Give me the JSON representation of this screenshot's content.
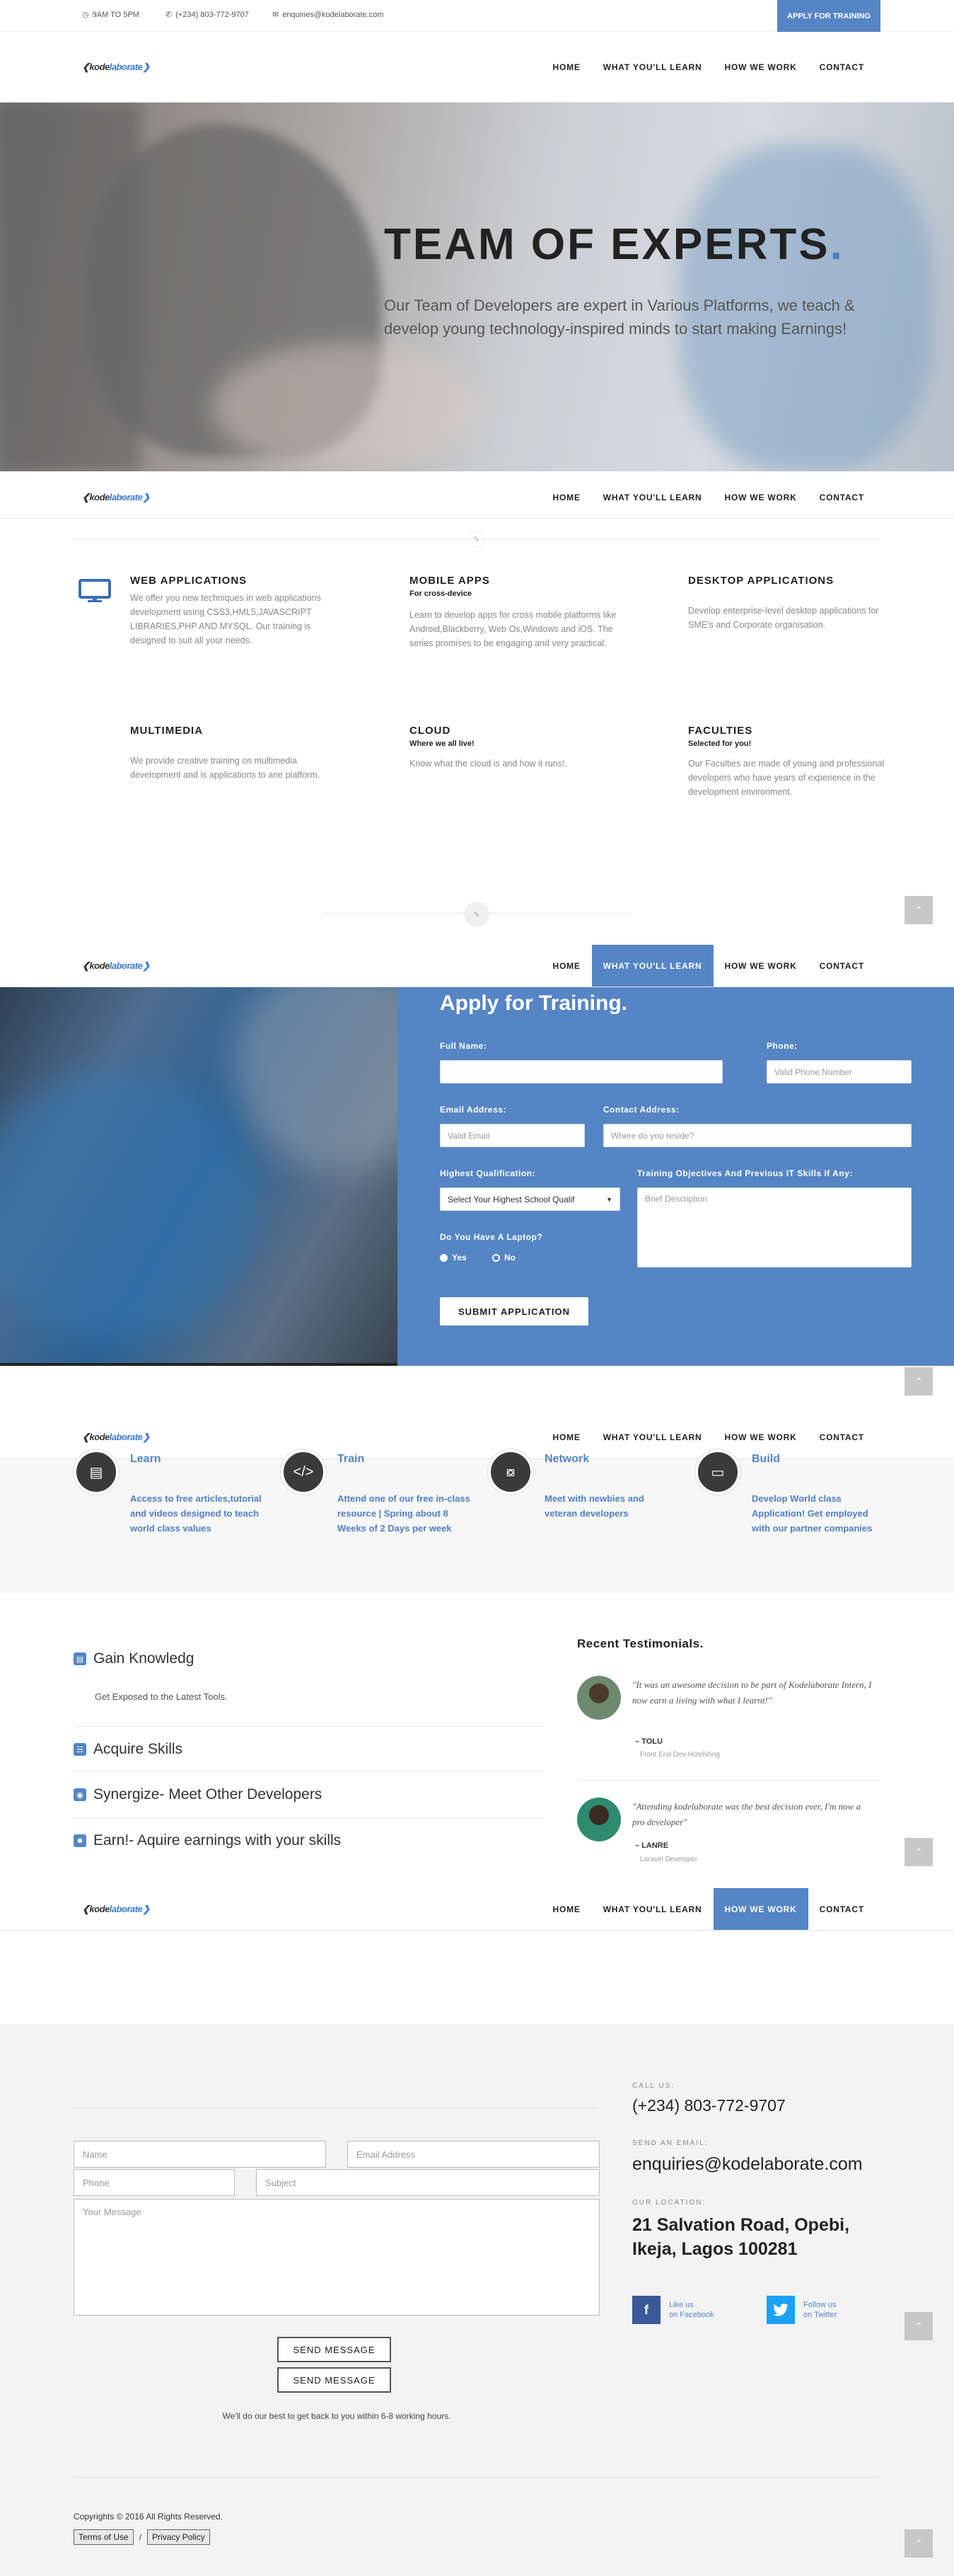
{
  "topbar": {
    "hours": "9AM TO 5PM",
    "phone": "(+234) 803-772-9707",
    "email": "enquiries@kodelaborate.com",
    "apply_label": "APPLY FOR TRAINING"
  },
  "logo": {
    "part1": "kode",
    "part2": "laborate"
  },
  "nav": {
    "items": [
      "HOME",
      "WHAT YOU'LL LEARN",
      "HOW WE WORK",
      "CONTACT"
    ]
  },
  "hero": {
    "title": "TEAM OF EXPERTS",
    "title_dot": ".",
    "subtitle": "Our Team of Developers are expert in Various Platforms, we teach & develop young technology-inspired minds to start making Earnings!"
  },
  "services": [
    {
      "title": "WEB APPLICATIONS",
      "subtitle": "",
      "text": "We offer you new techniques in web applications development using CSS3,HML5,JAVASCRIPT LIBRARIES,PHP AND MYSQL. Our training is designed to suit all your needs."
    },
    {
      "title": "MOBILE APPS",
      "subtitle": "For cross-device",
      "text": "Learn to develop apps for cross mobile platforms like Android,Blackberry, Web Os,Windows and iOS. The series promises to be engaging and very practical."
    },
    {
      "title": "DESKTOP APPLICATIONS",
      "subtitle": "",
      "text": "Develop enterprise-level desktop applications for SME's and Corporate organisation."
    },
    {
      "title": "MULTIMEDIA",
      "subtitle": "",
      "text": "We provide creative training on multimedia development and is applications to ane platform."
    },
    {
      "title": "CLOUD",
      "subtitle": "Where we all live!",
      "text": "Know what the cloud is and how it runs!."
    },
    {
      "title": "FACULTIES",
      "subtitle": "Selected for you!",
      "text": "Our Faculties are made of young and professional developers who have years of experience in the development environment."
    }
  ],
  "apply": {
    "title": "Apply for Training.",
    "full_name_label": "Full Name:",
    "phone_label": "Phone:",
    "phone_placeholder": "Valid Phone Number",
    "email_label": "Email Address:",
    "email_placeholder": "Valid Email",
    "contact_label": "Contact Address:",
    "contact_placeholder": "Where do you reside?",
    "qualification_label": "Highest Qualification:",
    "qualification_value": "Select Your Highest School Qualif",
    "objectives_label": "Training Objectives And Previous IT Skills If Any:",
    "objectives_placeholder": "Brief Description",
    "laptop_label": "Do You Have A Laptop?",
    "yes": "Yes",
    "no": "No",
    "submit": "SUBMIT APPLICATION"
  },
  "features": [
    {
      "title": "Learn",
      "text": "Access to free articles,tutorial and videos designed to teach world class values",
      "icon": "book-icon"
    },
    {
      "title": "Train",
      "text": "Attend one of our free in-class resource | Spring about 8 Weeks of 2 Days per week",
      "icon": "code-icon"
    },
    {
      "title": "Network",
      "text": "Meet with newbies and veteran developers",
      "icon": "share-icon"
    },
    {
      "title": "Build",
      "text": "Develop World class Application! Get employed with our partner companies",
      "icon": "monitor-icon"
    }
  ],
  "skills": {
    "items": [
      {
        "label": "Gain Knowledg",
        "icon": "book-icon"
      },
      {
        "label": "Acquire Skills",
        "icon": "sitemap-icon"
      },
      {
        "label": "Synergize- Meet Other Developers",
        "icon": "eye-icon"
      },
      {
        "label": "Earn!- Aquire earnings with your skills",
        "icon": "head-icon"
      }
    ],
    "detail": "Get Exposed to the Latest Tools."
  },
  "testimonials": {
    "title": "Recent Testimonials.",
    "items": [
      {
        "quote": "\"It was an awesome decision to be part of Kodelaborate Intern, I now earn a living with what I learnt!\"",
        "name": "– TOLU",
        "role": "Front End Dev-Hotelshng"
      },
      {
        "quote": "\"Attending kodelaborate was the best decision ever, I'm now a pro developer\"",
        "name": "– LANRE",
        "role": "Laravel Developer"
      }
    ]
  },
  "contact": {
    "name_placeholder": "Name",
    "email_placeholder": "Email Address",
    "phone_placeholder": "Phone",
    "subject_placeholder": "Subject",
    "message_placeholder": "Your Message",
    "send_label": "SEND MESSAGE",
    "note": "We'll do our best to get back to you within 6-8 working hours.",
    "call_label": "CALL US:",
    "call_value": "(+234) 803-772-9707",
    "email_label": "SEND AN EMAIL:",
    "email_value": "enquiries@kodelaborate.com",
    "location_label": "OUR LOCATION:",
    "location_line1": "21 Salvation Road, Opebi,",
    "location_line2": "Ikeja, Lagos 100281",
    "facebook": {
      "line1": "Like us",
      "line2": "on Facebook",
      "letter": "f"
    },
    "twitter": {
      "line1": "Follow us",
      "line2": "on Twitter"
    }
  },
  "footer": {
    "copyright": "Copyrights © 2016 All Rights Reserved.",
    "terms": "Terms of Use",
    "sep": "/",
    "privacy": "Privacy Policy"
  },
  "colors": {
    "accent": "#5585c4",
    "dark": "#222222"
  }
}
